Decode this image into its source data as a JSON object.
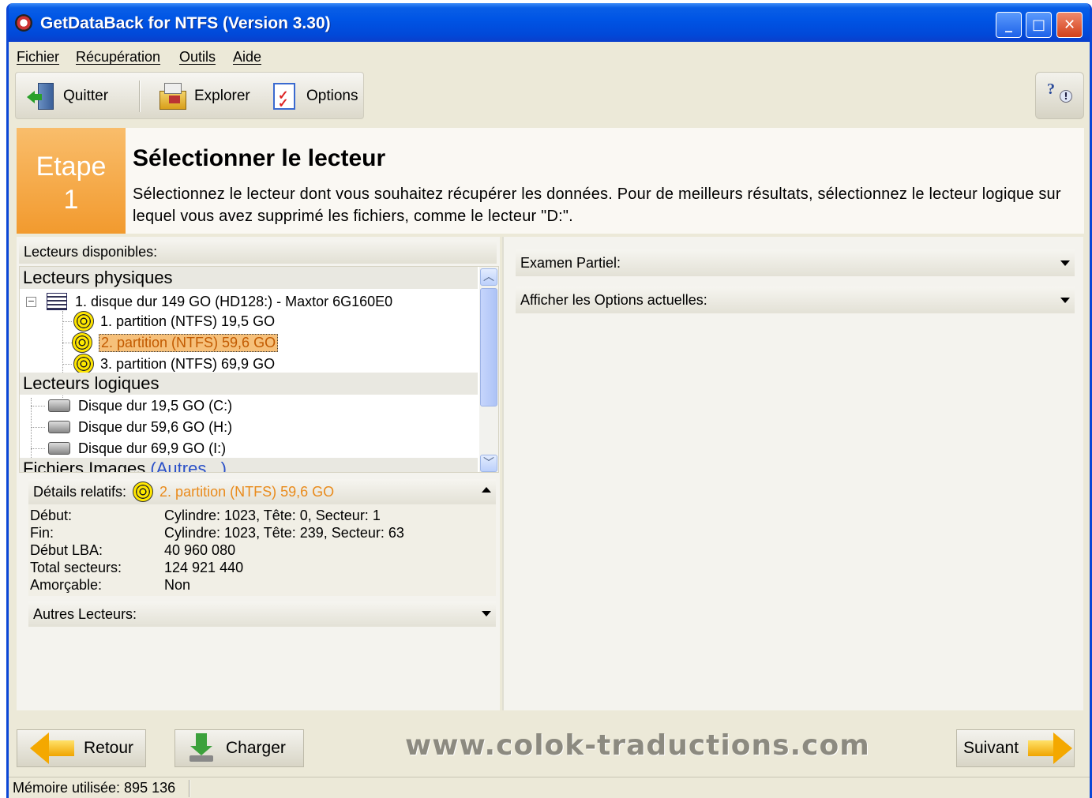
{
  "window": {
    "title": "GetDataBack for NTFS (Version 3.30)"
  },
  "menu": [
    "Fichier",
    "Récupération",
    "Outils",
    "Aide"
  ],
  "toolbar": {
    "quit": "Quitter",
    "explore": "Explorer",
    "options": "Options"
  },
  "step": {
    "label": "Etape",
    "number": "1",
    "title": "Sélectionner le lecteur",
    "description": "Sélectionnez le lecteur dont vous souhaitez récupérer les données. Pour de meilleurs résultats, sélectionnez le lecteur logique sur lequel vous avez supprimé les fichiers, comme le lecteur \"D:\"."
  },
  "drives": {
    "header": "Lecteurs disponibles:",
    "physical_group": "Lecteurs physiques",
    "physical_disk": "1. disque dur 149 GO (HD128:) - Maxtor 6G160E0",
    "partitions": [
      "1. partition (NTFS) 19,5 GO",
      "2. partition (NTFS) 59,6 GO",
      "3. partition (NTFS) 69,9 GO"
    ],
    "logical_group": "Lecteurs logiques",
    "logical": [
      "Disque dur 19,5 GO (C:)",
      "Disque dur 59,6 GO (H:)",
      "Disque dur 69,9 GO (I:)"
    ],
    "images_group": "Fichiers Images",
    "images_extra": "(Autres...)"
  },
  "details": {
    "header": "Détails relatifs:",
    "selected": "2. partition (NTFS) 59,6 GO",
    "rows": [
      {
        "key": "Début:",
        "value": "Cylindre: 1023, Tête: 0, Secteur: 1"
      },
      {
        "key": "Fin:",
        "value": "Cylindre: 1023, Tête: 239, Secteur: 63"
      },
      {
        "key": "Début LBA:",
        "value": "40 960 080"
      },
      {
        "key": "Total secteurs:",
        "value": "124 921 440"
      },
      {
        "key": "Amorçable:",
        "value": "Non"
      }
    ]
  },
  "other_drives": "Autres Lecteurs:",
  "right": {
    "scan": "Examen Partiel:",
    "options": "Afficher les Options actuelles:"
  },
  "nav": {
    "back": "Retour",
    "load": "Charger",
    "next": "Suivant"
  },
  "watermark": "www.colok-traductions.com",
  "status": {
    "memory": "Mémoire utilisée: 895 136"
  }
}
